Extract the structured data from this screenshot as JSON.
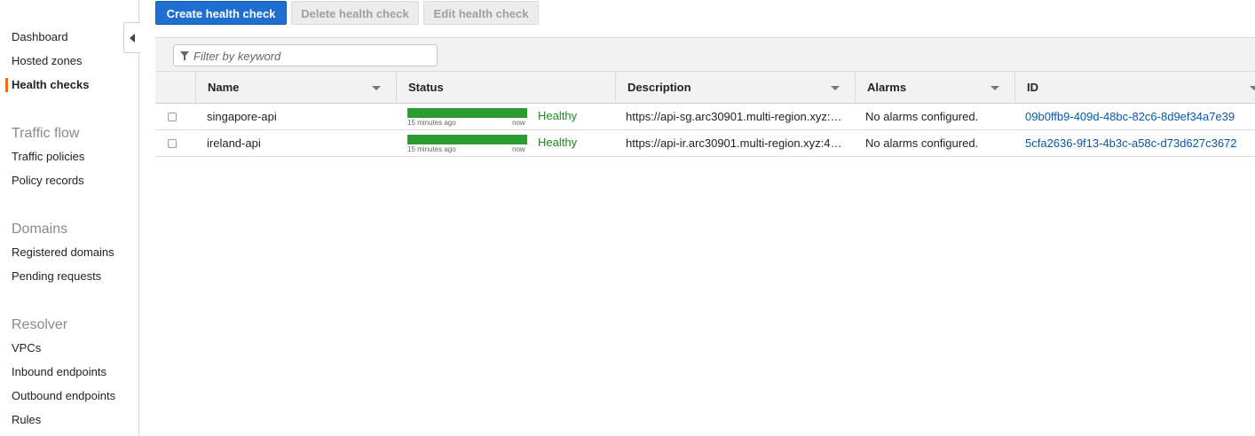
{
  "sidebar": {
    "items": [
      {
        "label": "Dashboard"
      },
      {
        "label": "Hosted zones"
      },
      {
        "label": "Health checks"
      }
    ],
    "sections": [
      {
        "title": "Traffic flow",
        "items": [
          {
            "label": "Traffic policies"
          },
          {
            "label": "Policy records"
          }
        ]
      },
      {
        "title": "Domains",
        "items": [
          {
            "label": "Registered domains"
          },
          {
            "label": "Pending requests"
          }
        ]
      },
      {
        "title": "Resolver",
        "items": [
          {
            "label": "VPCs"
          },
          {
            "label": "Inbound endpoints"
          },
          {
            "label": "Outbound endpoints"
          },
          {
            "label": "Rules"
          }
        ]
      }
    ]
  },
  "toolbar": {
    "create_label": "Create health check",
    "delete_label": "Delete health check",
    "edit_label": "Edit health check"
  },
  "filter": {
    "placeholder": "Filter by keyword"
  },
  "table": {
    "columns": [
      "Name",
      "Status",
      "Description",
      "Alarms",
      "ID"
    ],
    "rows": [
      {
        "name": "singapore-api",
        "bar_start": "15 minutes ago",
        "bar_end": "now",
        "status": "Healthy",
        "description": "https://api-sg.arc30901.multi-region.xyz:…",
        "alarms": "No alarms configured.",
        "id": "09b0ffb9-409d-48bc-82c6-8d9ef34a7e39"
      },
      {
        "name": "ireland-api",
        "bar_start": "15 minutes ago",
        "bar_end": "now",
        "status": "Healthy",
        "description": "https://api-ir.arc30901.multi-region.xyz:4…",
        "alarms": "No alarms configured.",
        "id": "5cfa2636-9f13-4b3c-a58c-d73d627c3672"
      }
    ]
  },
  "colors": {
    "primary": "#1f6fd0",
    "healthy": "#2c9b32",
    "active_marker": "#e8701a",
    "link": "#0a57a8"
  }
}
